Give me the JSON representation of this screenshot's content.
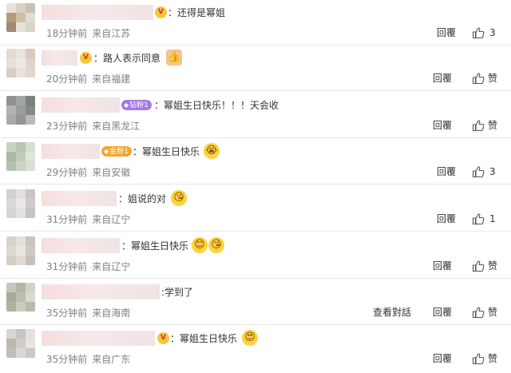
{
  "comments": [
    {
      "text": "：还得是幂姐",
      "time": "18分钟前",
      "location": "来自江苏",
      "reply_label": "回覆",
      "like_count": "3",
      "avatar_colors": [
        "#e8e3d8",
        "#d9d2c4",
        "#c8c1b5",
        "#b49a7a",
        "#cdbfa5",
        "#e2ddd2",
        "#9d8a74",
        "#e6e1d6",
        "#dad4c8"
      ]
    },
    {
      "text": "：路人表示同意",
      "time": "20分钟前",
      "location": "来自福建",
      "reply_label": "回覆",
      "like_label": "赞",
      "avatar_colors": [
        "#e6d8cf",
        "#ede3dd",
        "#d9c9bf",
        "#e9dfd7",
        "#f0e9e4",
        "#e2d2c7",
        "#dccdc2",
        "#ebe1da",
        "#e5d7cd"
      ]
    },
    {
      "text": "：幂姐生日快乐！！！天会收",
      "fan_badge": "钻粉1",
      "time": "23分钟前",
      "location": "来自黑龙江",
      "reply_label": "回覆",
      "like_label": "赞",
      "avatar_colors": [
        "#8f9390",
        "#a2a6a3",
        "#7d817e",
        "#b1b4b1",
        "#9a9d9a",
        "#878b88",
        "#a8aba8",
        "#929693",
        "#b7bab7"
      ]
    },
    {
      "text": "：幂姐生日快乐",
      "fan_badge": "金粉1",
      "time": "29分钟前",
      "location": "来自安徽",
      "reply_label": "回覆",
      "like_count": "3",
      "avatar_colors": [
        "#c9d3c4",
        "#b8c5b2",
        "#d6ddd2",
        "#a9b9a2",
        "#c1ccbb",
        "#e0e6dc",
        "#b3c1ac",
        "#cbd5c5",
        "#d9dfd5"
      ]
    },
    {
      "text": "：姐说的对",
      "time": "31分钟前",
      "location": "来自辽宁",
      "reply_label": "回覆",
      "like_count": "1",
      "avatar_colors": [
        "#d4cfd1",
        "#e2dee0",
        "#c9c4c6",
        "#ddd9db",
        "#ebe8e9",
        "#cfcacc",
        "#d8d3d5",
        "#e4e0e2",
        "#c6c1c3"
      ]
    },
    {
      "text": "：幂姐生日快乐",
      "time": "31分钟前",
      "location": "来自辽宁",
      "reply_label": "回覆",
      "like_label": "赞",
      "avatar_colors": [
        "#d7d2cc",
        "#e4e0db",
        "#cac4bd",
        "#ddd8d2",
        "#e9e5e0",
        "#cfc9c2",
        "#d3cdc6",
        "#e0dbd5",
        "#c7c0b8"
      ]
    },
    {
      "text": ":学到了",
      "time": "35分钟前",
      "location": "来自海南",
      "dialog_label": "查看對話",
      "reply_label": "回覆",
      "like_label": "赞",
      "avatar_colors": [
        "#c4c9b9",
        "#b3b8a6",
        "#d0d4c6",
        "#a7ac98",
        "#bcc1af",
        "#d8dbcf",
        "#aeb3a0",
        "#c9cdbf",
        "#b8bcaa"
      ]
    },
    {
      "text": "：幂姐生日快乐",
      "time": "35分钟前",
      "location": "来自广东",
      "reply_label": "回覆",
      "like_label": "赞",
      "avatar_colors": [
        "#d9d5d2",
        "#c8c3bf",
        "#e3e0dd",
        "#bdb7b2",
        "#d1ccc8",
        "#e7e4e2",
        "#c3bdb8",
        "#dbd7d4",
        "#cdc8c4"
      ]
    }
  ]
}
